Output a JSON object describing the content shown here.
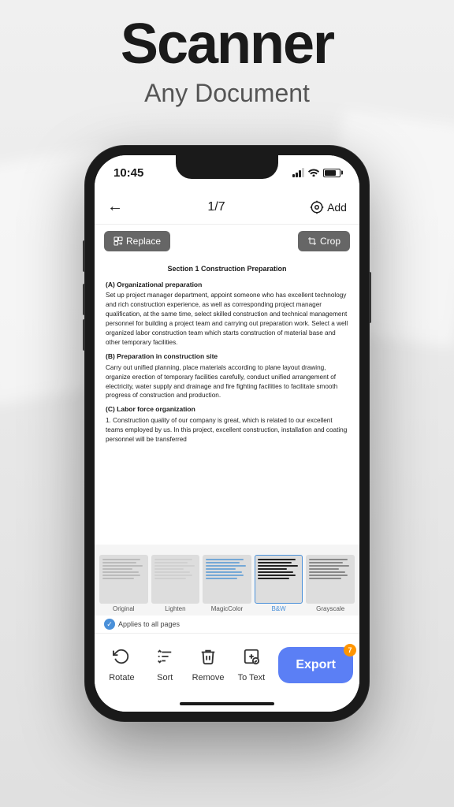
{
  "header": {
    "title": "Scanner",
    "subtitle": "Any Document"
  },
  "status_bar": {
    "time": "10:45",
    "signal": "signal",
    "wifi": "wifi",
    "battery": "battery"
  },
  "nav": {
    "back_label": "←",
    "page_indicator": "1/7",
    "add_icon": "camera",
    "add_label": "Add"
  },
  "toolbar": {
    "replace_label": "Replace",
    "crop_label": "Crop"
  },
  "document": {
    "title": "Section 1 Construction Preparation",
    "sections": [
      {
        "heading": "(A) Organizational preparation",
        "text": "Set up project manager department, appoint someone who has excellent technology and rich construction experience, as well as corresponding project manager qualification, at the same time, select skilled construction and technical management personnel for building a project team and carrying out preparation work. Select a well organized labor construction team which starts construction of material base and other temporary facilities."
      },
      {
        "heading": "(B) Preparation in construction site",
        "text": "Carry out unified planning, place materials according to plane layout drawing, organize erection of temporary facilities carefully, conduct unified arrangement of electricity, water supply and drainage and fire fighting facilities to facilitate smooth progress of construction and production."
      },
      {
        "heading": "(C) Labor force organization",
        "text": "1. Construction quality of our company is great, which is related to our excellent teams employed by us. In this project, excellent construction, installation and coating personnel will be transferred"
      }
    ]
  },
  "filters": [
    {
      "label": "Original",
      "active": false,
      "style": "original"
    },
    {
      "label": "Lighten",
      "active": false,
      "style": "lighten"
    },
    {
      "label": "MagicColor",
      "active": false,
      "style": "magic"
    },
    {
      "label": "B&W",
      "active": true,
      "style": "bw"
    },
    {
      "label": "Grayscale",
      "active": false,
      "style": "grayscale"
    }
  ],
  "applies_note": "Applies to all pages",
  "actions": [
    {
      "label": "Rotate",
      "icon": "rotate"
    },
    {
      "label": "Sort",
      "icon": "sort"
    },
    {
      "label": "Remove",
      "icon": "remove"
    },
    {
      "label": "To Text",
      "icon": "to-text"
    }
  ],
  "export_button": {
    "label": "Export",
    "badge": "7"
  }
}
